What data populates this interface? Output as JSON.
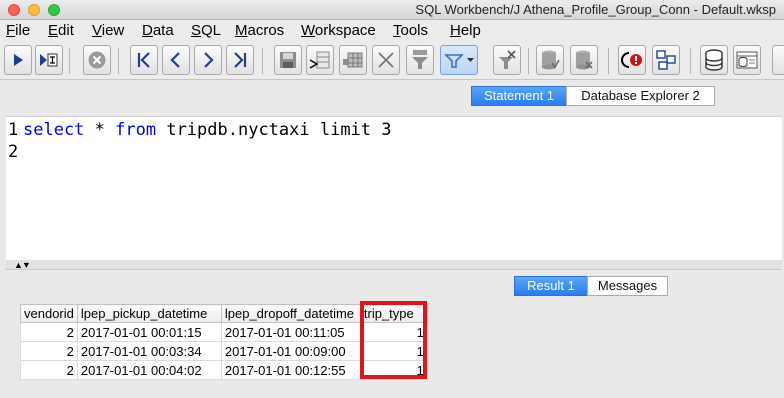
{
  "window": {
    "title": "SQL Workbench/J Athena_Profile_Group_Conn - Default.wksp"
  },
  "menu": {
    "items": [
      {
        "u": "F",
        "rest": "ile"
      },
      {
        "u": "E",
        "rest": "dit"
      },
      {
        "u": "V",
        "rest": "iew"
      },
      {
        "u": "D",
        "rest": "ata"
      },
      {
        "u": "S",
        "rest": "QL"
      },
      {
        "u": "M",
        "rest": "acros"
      },
      {
        "u": "W",
        "rest": "orkspace"
      },
      {
        "u": "T",
        "rest": "ools"
      },
      {
        "u": "H",
        "rest": "elp"
      }
    ]
  },
  "toolbar": {
    "icons": [
      "execute-icon",
      "execute-current-icon",
      "stop-icon",
      "first-page-icon",
      "previous-page-icon",
      "next-page-icon",
      "last-page-icon",
      "save-icon",
      "insert-row-icon",
      "copy-row-icon",
      "delete-row-icon",
      "filter-icon",
      "filter-dropdown-icon",
      "clear-filter-icon",
      "commit-icon",
      "rollback-icon",
      "stop-on-error-icon",
      "layout-icon",
      "database-icon",
      "db-explorer-icon"
    ]
  },
  "top_tabs": [
    {
      "label": "Statement 1",
      "active": true
    },
    {
      "label": "Database Explorer 2",
      "active": false
    }
  ],
  "editor": {
    "line_numbers": [
      "1",
      "2"
    ],
    "kw1": "select",
    "plain1": " * ",
    "kw2": "from",
    "plain2": " tripdb.nyctaxi limit 3"
  },
  "result_tabs": [
    {
      "label": "Result 1",
      "active": true
    },
    {
      "label": "Messages",
      "active": false
    }
  ],
  "results": {
    "columns": [
      "vendorid",
      "lpep_pickup_datetime",
      "lpep_dropoff_datetime",
      "trip_type"
    ],
    "rows": [
      [
        "2",
        "2017-01-01 00:01:15",
        "2017-01-01 00:11:05",
        "1"
      ],
      [
        "2",
        "2017-01-01 00:03:34",
        "2017-01-01 00:09:00",
        "1"
      ],
      [
        "2",
        "2017-01-01 00:04:02",
        "2017-01-01 00:12:55",
        "1"
      ]
    ],
    "highlighted_column": "trip_type",
    "highlight_color": "#e0141e"
  }
}
